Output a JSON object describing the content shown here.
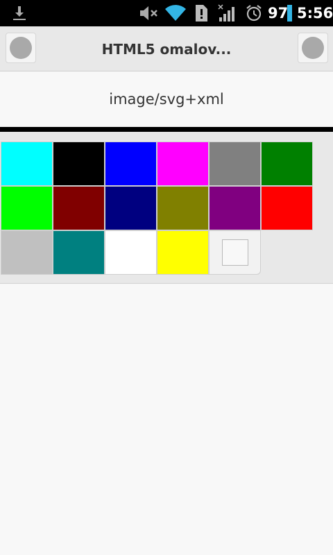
{
  "status_bar": {
    "battery_percent": "97",
    "time": "5:56",
    "icons": [
      "download-icon",
      "mute-icon",
      "wifi-icon",
      "sim-alert-icon",
      "signal-icon",
      "alarm-icon",
      "battery-icon"
    ]
  },
  "header": {
    "title": "HTML5 omalov...",
    "left_button_icon": "circle-icon",
    "right_button_icon": "circle-icon"
  },
  "content": {
    "mime_type": "image/svg+xml"
  },
  "palette": {
    "colors": [
      "#00ffff",
      "#000000",
      "#0000ff",
      "#ff00ff",
      "#808080",
      "#008000",
      "#00ff00",
      "#800000",
      "#000080",
      "#808000",
      "#800080",
      "#ff0000",
      "#c0c0c0",
      "#008080",
      "#ffffff",
      "#ffff00"
    ],
    "last_item": "eraser-icon"
  },
  "colors": {
    "header_bg": "#e8e8e8",
    "status_bar_bg": "#000000",
    "battery_accent": "#33b5e5",
    "wifi_accent": "#33b5e5"
  }
}
